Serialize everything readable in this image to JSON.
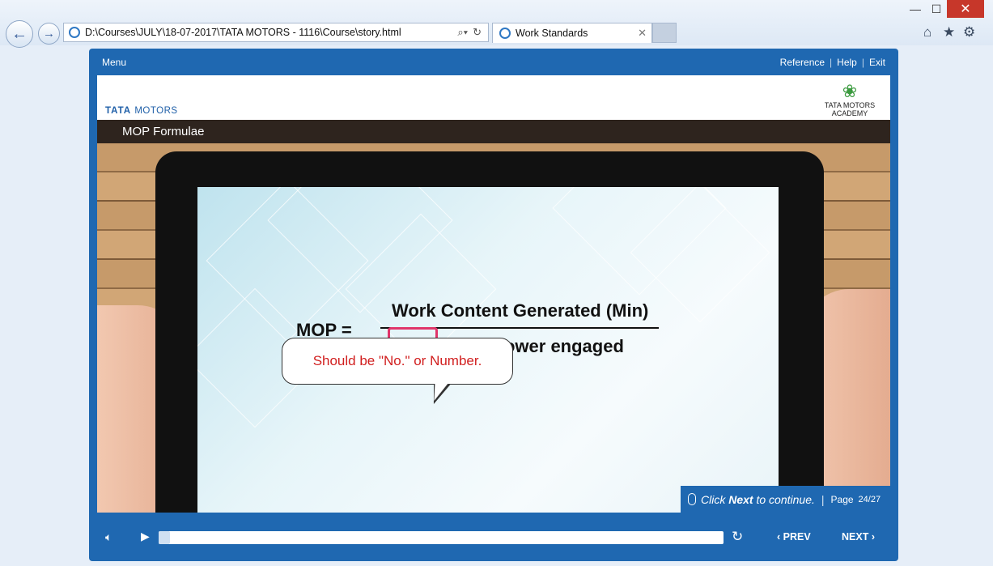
{
  "browser": {
    "address": "D:\\Courses\\JULY\\18-07-2017\\TATA MOTORS - 1116\\Course\\story.html",
    "tab_title": "Work Standards",
    "window_controls": {
      "minimize": "—",
      "maximize": "☐",
      "close": "✕"
    },
    "icons": [
      "back-icon",
      "forward-icon",
      "search-icon",
      "refresh-icon",
      "home-icon",
      "favorites-star-icon",
      "settings-gear-icon"
    ]
  },
  "player": {
    "menu_label": "Menu",
    "links": [
      "Reference",
      "Help",
      "Exit"
    ],
    "brand": {
      "tata": "TATA",
      "motors": "MOTORS",
      "academy": "TATA MOTORS ACADEMY"
    },
    "slide_title": "MOP Formulae",
    "formula": {
      "lhs": "MOP  =",
      "numerator": "Work Content Generated (Min)",
      "denominator": "No of manpower engaged"
    },
    "callout": "Should be \"No.\" or Number.",
    "continue": {
      "click": "Click ",
      "next": "Next",
      "rest": " to continue.",
      "separator": "|",
      "page_label": "Page",
      "page_value": "24/27"
    },
    "nav": {
      "prev": "PREV",
      "next": "NEXT"
    },
    "progress": 0.02,
    "colors": {
      "accent": "#1f68b1",
      "title_bar": "#2e241e",
      "callout_text": "#d11f1f",
      "highlight": "#e0356a"
    }
  }
}
